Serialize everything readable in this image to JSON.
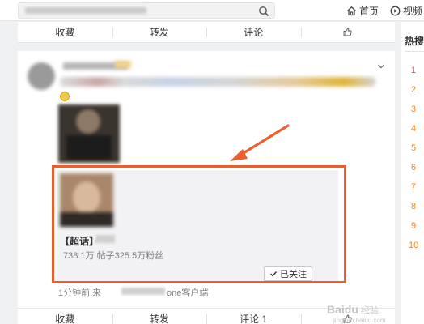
{
  "topbar": {
    "home_label": "首页",
    "video_label": "视频"
  },
  "feed_actions_top": [
    "收藏",
    "转发",
    "评论"
  ],
  "feed_actions_bottom": [
    "收藏",
    "转发",
    "评论 1"
  ],
  "post": {
    "super_topic": {
      "title": "【超话】",
      "stats": "738.1万  帖子325.5万粉丝",
      "follow_label": "已关注"
    },
    "meta_prefix": "1分钟前 来",
    "meta_suffix": "one客户端"
  },
  "sidebar": {
    "title": "热搜",
    "ranks": [
      "1",
      "2",
      "3",
      "4",
      "5",
      "6",
      "7",
      "8",
      "9",
      "10"
    ]
  },
  "watermark": {
    "brand": "Baidu",
    "sub": "经验",
    "url": "jingyan.baidu.com"
  },
  "colors": {
    "annotation": "#ee5d2c",
    "rank_top": "#ff3b30",
    "rank": "#ff8200"
  }
}
